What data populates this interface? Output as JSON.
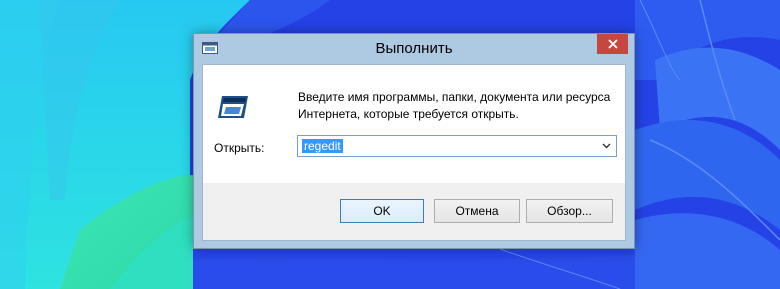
{
  "window": {
    "title": "Выполнить",
    "description_line1": "Введите имя программы, папки, документа или ресурса",
    "description_line2": "Интернета, которые требуется открыть.",
    "open_label": "Открыть:",
    "open_value": "regedit",
    "ok_label": "OK",
    "cancel_label": "Отмена",
    "browse_label": "Обзор..."
  },
  "icons": {
    "title": "run-app-icon",
    "content": "run-app-icon",
    "close": "close-icon",
    "dropdown": "chevron-down-icon"
  },
  "colors": {
    "title_bar": "#aec9e2",
    "close_button": "#c7463f",
    "selection": "#3399ff",
    "desktop_blue": "#1f3fe0",
    "desktop_cyan": "#27dfee"
  }
}
